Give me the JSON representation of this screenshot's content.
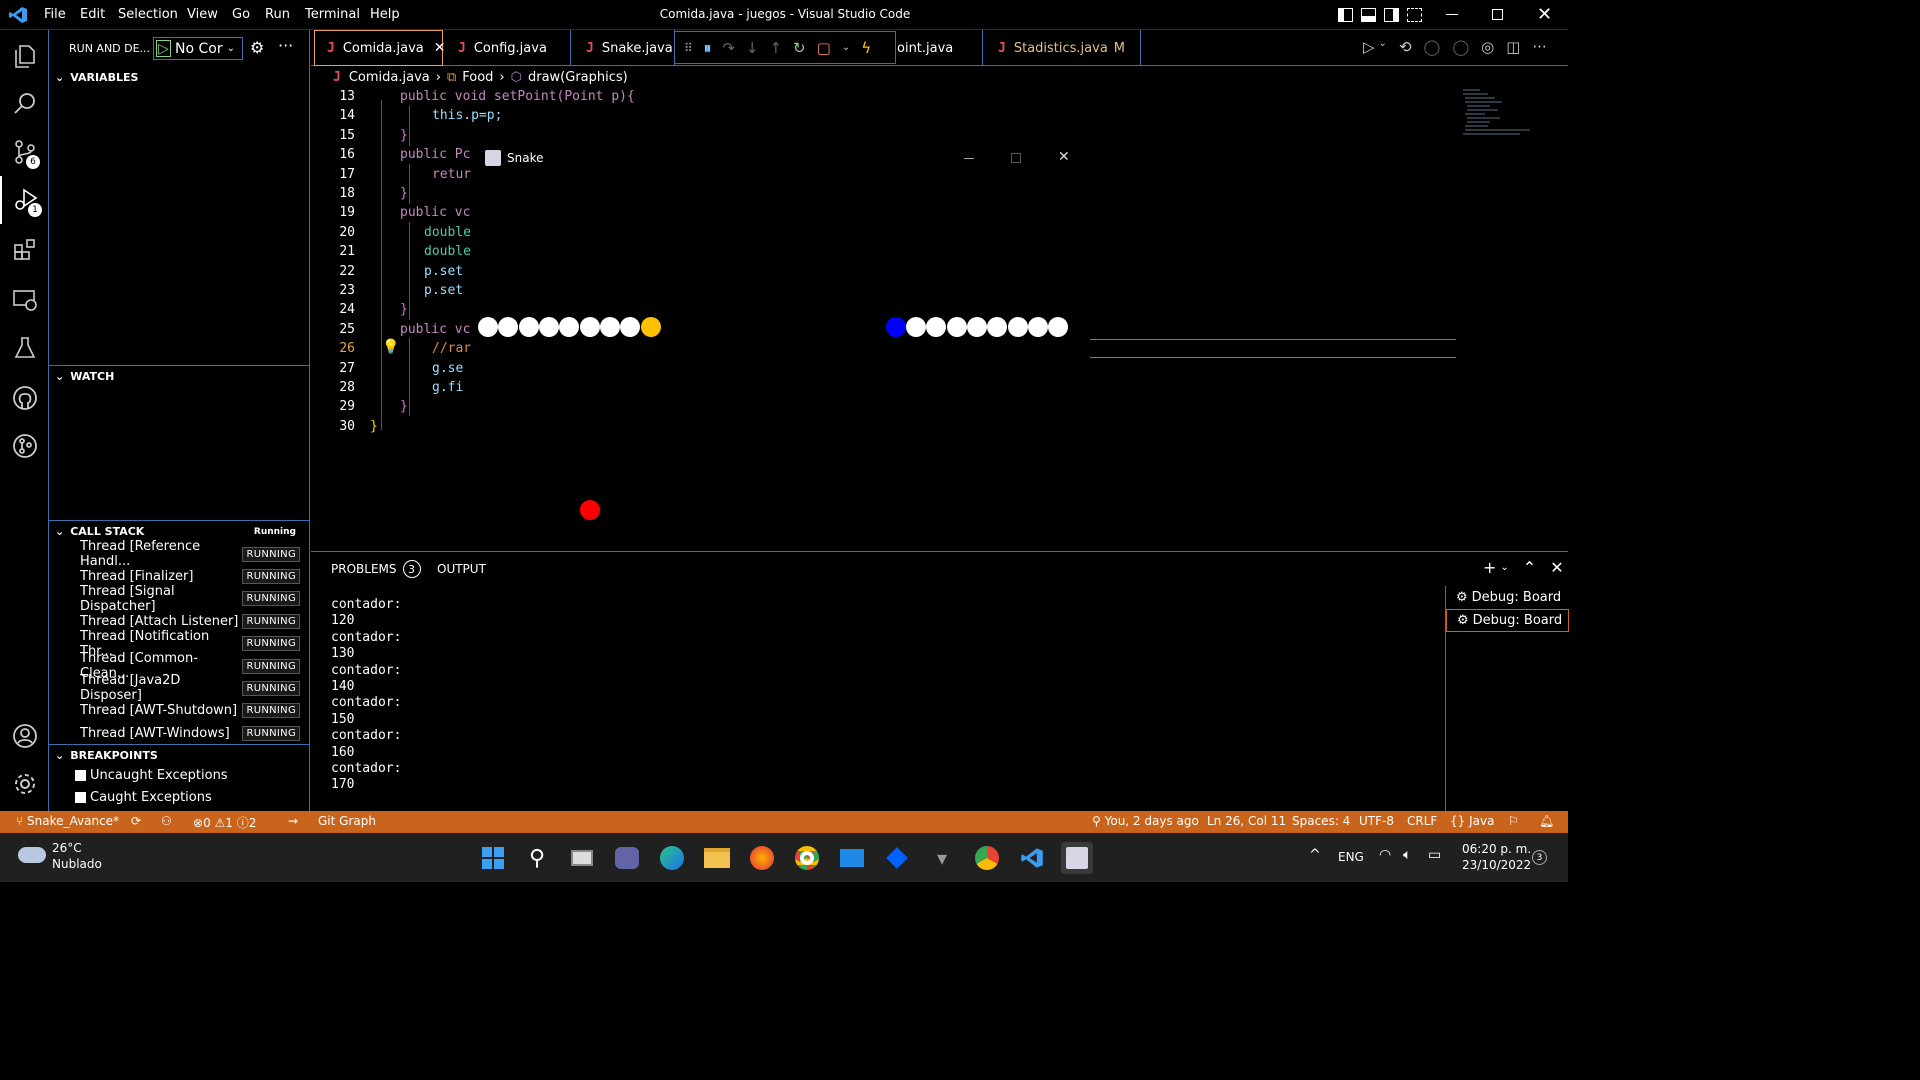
{
  "titlebar": {
    "menu": [
      "File",
      "Edit",
      "Selection",
      "View",
      "Go",
      "Run",
      "Terminal",
      "Help"
    ],
    "title": "Comida.java - juegos - Visual Studio Code"
  },
  "activity": {
    "scm_badge": "6",
    "debug_badge": "1"
  },
  "sidebar": {
    "header": "RUN AND DE...",
    "config": "No Cor",
    "variables": "VARIABLES",
    "watch": "WATCH",
    "callstack": "CALL STACK",
    "callstack_state": "Running",
    "threads": [
      {
        "name": "Thread [Reference Handl...",
        "state": "RUNNING"
      },
      {
        "name": "Thread [Finalizer]",
        "state": "RUNNING"
      },
      {
        "name": "Thread [Signal Dispatcher]",
        "state": "RUNNING"
      },
      {
        "name": "Thread [Attach Listener]",
        "state": "RUNNING"
      },
      {
        "name": "Thread [Notification Thr...",
        "state": "RUNNING"
      },
      {
        "name": "Thread [Common-Clean...",
        "state": "RUNNING"
      },
      {
        "name": "Thread [Java2D Disposer]",
        "state": "RUNNING"
      },
      {
        "name": "Thread [AWT-Shutdown]",
        "state": "RUNNING"
      },
      {
        "name": "Thread [AWT-Windows]",
        "state": "RUNNING"
      }
    ],
    "breakpoints": "BREAKPOINTS",
    "bp_items": [
      "Uncaught Exceptions",
      "Caught Exceptions"
    ]
  },
  "tabs": [
    {
      "label": "Comida.java",
      "active": true
    },
    {
      "label": "Config.java"
    },
    {
      "label": "Snake.java"
    },
    {
      "label": "oint.java"
    },
    {
      "label": "Stadistics.java",
      "badge": "M"
    }
  ],
  "breadcrumb": [
    "Comida.java",
    "Food",
    "draw(Graphics)"
  ],
  "code_lines": [
    {
      "n": "13",
      "t": "public void setPoint(Point p){"
    },
    {
      "n": "14",
      "t": "this.p=p;"
    },
    {
      "n": "15",
      "t": "}"
    },
    {
      "n": "16",
      "t": "public Pc"
    },
    {
      "n": "17",
      "t": "retur"
    },
    {
      "n": "18",
      "t": "}"
    },
    {
      "n": "19",
      "t": "public vc"
    },
    {
      "n": "20",
      "t": "double"
    },
    {
      "n": "21",
      "t": "double"
    },
    {
      "n": "22",
      "t": "p.set"
    },
    {
      "n": "23",
      "t": "p.set"
    },
    {
      "n": "24",
      "t": "}"
    },
    {
      "n": "25",
      "t": "public vc"
    },
    {
      "n": "26",
      "t": "//rar"
    },
    {
      "n": "27",
      "t": "g.se"
    },
    {
      "n": "28",
      "t": "g.fi"
    },
    {
      "n": "29",
      "t": "}"
    },
    {
      "n": "30",
      "t": "}"
    }
  ],
  "snake_window": {
    "title": "Snake"
  },
  "panel": {
    "problems": "PROBLEMS",
    "problems_count": "3",
    "output": "OUTPUT",
    "terminal_lines": [
      "contador:",
      "120",
      "contador:",
      "130",
      "contador:",
      "140",
      "contador:",
      "150",
      "contador:",
      "160",
      "contador:",
      "170"
    ],
    "sessions": [
      "Debug: Board",
      "Debug: Board"
    ]
  },
  "status": {
    "branch": "Snake_Avance*",
    "errors": "0",
    "warnings": "1",
    "infos": "2",
    "gitgraph": "Git Graph",
    "blame": "You, 2 days ago",
    "position": "Ln 26, Col 11",
    "spaces": "Spaces: 4",
    "encoding": "UTF-8",
    "eol": "CRLF",
    "lang": "{} Java"
  },
  "taskbar": {
    "temp": "26°C",
    "weather": "Nublado",
    "lang": "ENG",
    "time": "06:20 p. m.",
    "date": "23/10/2022",
    "notif": "3"
  },
  "colors": {
    "status": "#c8641c",
    "accent": "#3a6fb0",
    "head_player1": "#ffc000",
    "head_player2": "#0000ff",
    "food": "#ff0000"
  }
}
